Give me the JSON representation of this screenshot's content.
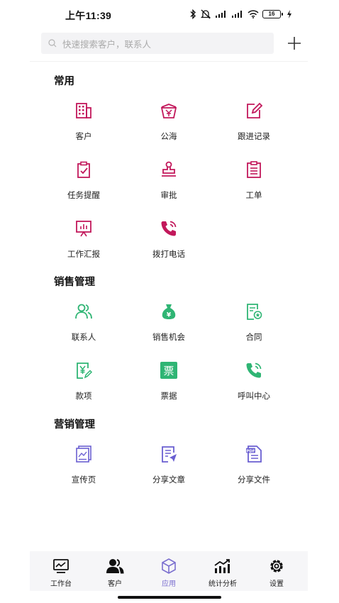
{
  "status_bar": {
    "time": "上午11:39",
    "battery": "16"
  },
  "search": {
    "placeholder": "快速搜索客户，联系人",
    "add_icon": "plus-icon"
  },
  "colors": {
    "common": "#c2185b",
    "sales": "#2fb574",
    "marketing": "#6a5fd1",
    "nav_active": "#7b6fcf"
  },
  "sections": [
    {
      "title": "常用",
      "items": [
        {
          "label": "客户",
          "icon": "building-icon"
        },
        {
          "label": "公海",
          "icon": "basket-icon"
        },
        {
          "label": "跟进记录",
          "icon": "edit-icon"
        },
        {
          "label": "任务提醒",
          "icon": "clipboard-check-icon"
        },
        {
          "label": "审批",
          "icon": "stamp-icon"
        },
        {
          "label": "工单",
          "icon": "list-doc-icon"
        },
        {
          "label": "工作汇报",
          "icon": "presentation-icon"
        },
        {
          "label": "拨打电话",
          "icon": "phone-call-icon"
        }
      ]
    },
    {
      "title": "销售管理",
      "items": [
        {
          "label": "联系人",
          "icon": "contacts-icon"
        },
        {
          "label": "销售机会",
          "icon": "money-bag-icon"
        },
        {
          "label": "合同",
          "icon": "contract-icon"
        },
        {
          "label": "款项",
          "icon": "payment-icon"
        },
        {
          "label": "票据",
          "icon": "ticket-icon"
        },
        {
          "label": "呼叫中心",
          "icon": "call-center-icon"
        }
      ]
    },
    {
      "title": "营销管理",
      "items": [
        {
          "label": "宣传页",
          "icon": "promo-page-icon"
        },
        {
          "label": "分享文章",
          "icon": "share-article-icon"
        },
        {
          "label": "分享文件",
          "icon": "pdf-file-icon"
        }
      ]
    }
  ],
  "bottom_nav": [
    {
      "label": "工作台",
      "icon": "dashboard-icon",
      "active": false
    },
    {
      "label": "客户",
      "icon": "customers-icon",
      "active": false
    },
    {
      "label": "应用",
      "icon": "apps-cube-icon",
      "active": true
    },
    {
      "label": "统计分析",
      "icon": "stats-icon",
      "active": false
    },
    {
      "label": "设置",
      "icon": "settings-gear-icon",
      "active": false
    }
  ],
  "ticket_glyph": "票"
}
